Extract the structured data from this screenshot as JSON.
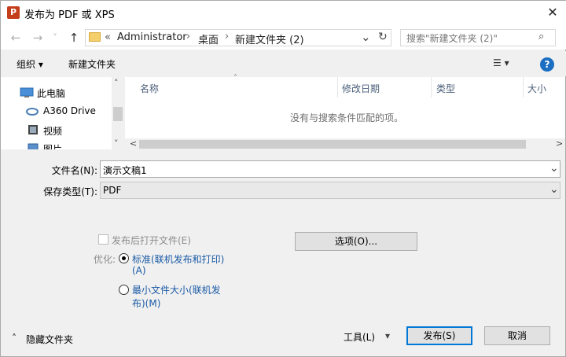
{
  "window": {
    "title": "发布为 PDF 或 XPS",
    "app_icon_letter": "P",
    "close_glyph": "✕"
  },
  "nav": {
    "back_glyph": "←",
    "forward_glyph": "→",
    "recent_glyph": "˅",
    "up_glyph": "↑",
    "breadcrumbs": {
      "overflow": "«",
      "item1": "Administrator",
      "item2": "桌面",
      "item3": "新建文件夹 (2)",
      "sep": "›"
    },
    "dropdown_glyph": "⌄",
    "refresh_glyph": "↻",
    "search_placeholder": "搜索\"新建文件夹 (2)\"",
    "search_glyph": "⌕"
  },
  "toolbar": {
    "organize": "组织 ▾",
    "new_folder": "新建文件夹",
    "view_glyph": "☰ ▾",
    "help_glyph": "?"
  },
  "tree": {
    "items": [
      {
        "label": "此电脑",
        "icon": "computer-icon"
      },
      {
        "label": "A360 Drive",
        "icon": "cloud-drive-icon"
      },
      {
        "label": "视频",
        "icon": "video-icon"
      },
      {
        "label": "图片",
        "icon": "pictures-icon"
      }
    ],
    "scroll_up": "˄",
    "scroll_down": "˅"
  },
  "files": {
    "columns": [
      "名称",
      "修改日期",
      "类型",
      "大小"
    ],
    "sort_glyph": "˄",
    "empty_message": "没有与搜索条件匹配的项。",
    "hscroll_left": "<",
    "hscroll_right": ">"
  },
  "form": {
    "filename_label": "文件名(N):",
    "filename_value": "演示文稿1",
    "filetype_label": "保存类型(T):",
    "filetype_value": "PDF",
    "open_after_label": "发布后打开文件(E)",
    "options_button": "选项(O)...",
    "optimize_label": "优化:",
    "standard_line1": "标准(联机发布和打印)",
    "standard_line2": "(A)",
    "minimum_line1": "最小文件大小(联机发",
    "minimum_line2": "布)(M)"
  },
  "footer": {
    "hide_folders_glyph": "˄",
    "hide_folders": "隐藏文件夹",
    "tools": "工具(L)",
    "tools_glyph": "▾",
    "publish": "发布(S)",
    "cancel": "取消"
  }
}
